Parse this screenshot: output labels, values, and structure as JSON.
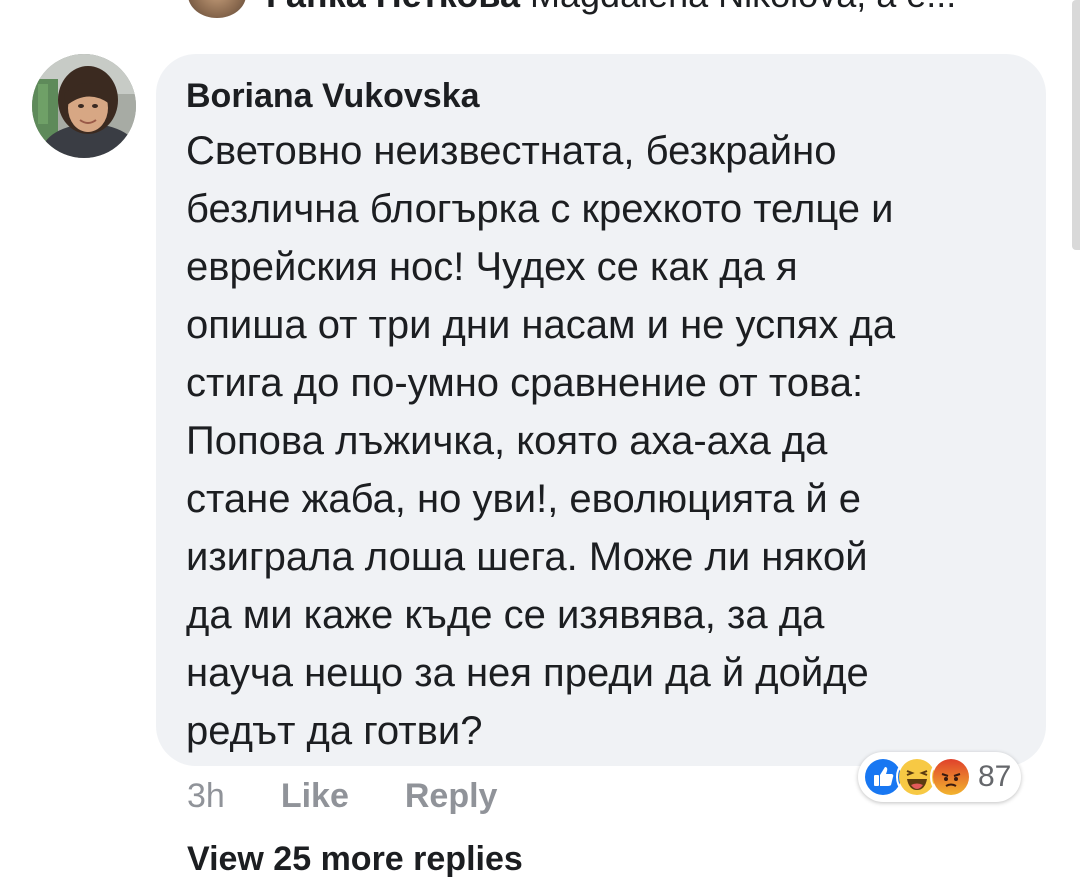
{
  "previous_comment": {
    "author": "Ганка Петкова",
    "text_fragment": " Magdalena Nikolova, а е..."
  },
  "comment": {
    "author": "Boriana Vukovska",
    "text_lines": [
      "Световно неизвестната, безкрайно",
      "безлична блогърка с крехкото телце и",
      "еврейския нос! Чудех се как да я",
      "опиша от три дни насам и не успях да",
      "стига до по-умно сравнение от това:",
      "Попова лъжичка, която аха-аха да",
      "стане жаба, но уви!, еволюцията й е",
      "изиграла лоша шега. Може ли някой",
      "да ми каже къде се изявява, за да",
      "науча нещо за нея преди да й дойде",
      "редът да готви?"
    ],
    "time": "3h",
    "like_label": "Like",
    "reply_label": "Reply",
    "reactions": {
      "icons": [
        "like-reaction-icon",
        "haha-reaction-icon",
        "angry-reaction-icon"
      ],
      "count": "87"
    }
  },
  "view_more_replies": "View 25 more replies",
  "colors": {
    "bubble": "#f0f2f5",
    "text": "#1c1e21",
    "meta": "#909399",
    "like_blue": "#1877f2",
    "haha_yellow": "#f7c944",
    "angry_orange": "#e9710f"
  }
}
